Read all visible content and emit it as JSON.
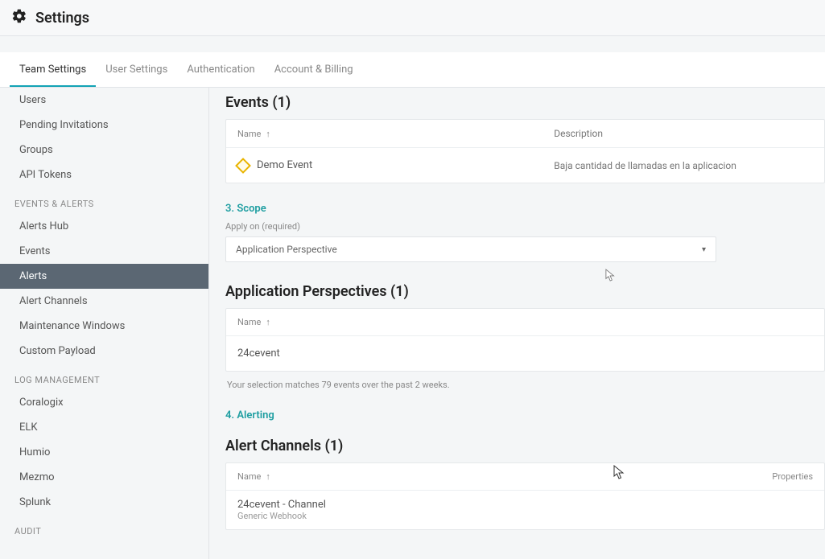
{
  "header": {
    "title": "Settings"
  },
  "tabs": [
    {
      "label": "Team Settings",
      "active": true
    },
    {
      "label": "User Settings"
    },
    {
      "label": "Authentication"
    },
    {
      "label": "Account & Billing"
    }
  ],
  "sidebar": {
    "groups": [
      {
        "label": "",
        "items": [
          {
            "label": "Users"
          },
          {
            "label": "Pending Invitations"
          },
          {
            "label": "Groups"
          },
          {
            "label": "API Tokens"
          }
        ]
      },
      {
        "label": "EVENTS & ALERTS",
        "items": [
          {
            "label": "Alerts Hub"
          },
          {
            "label": "Events"
          },
          {
            "label": "Alerts",
            "active": true
          },
          {
            "label": "Alert Channels"
          },
          {
            "label": "Maintenance Windows"
          },
          {
            "label": "Custom Payload"
          }
        ]
      },
      {
        "label": "LOG MANAGEMENT",
        "items": [
          {
            "label": "Coralogix"
          },
          {
            "label": "ELK"
          },
          {
            "label": "Humio"
          },
          {
            "label": "Mezmo"
          },
          {
            "label": "Splunk"
          }
        ]
      },
      {
        "label": "AUDIT",
        "items": []
      }
    ]
  },
  "main": {
    "events": {
      "heading": "Events (1)",
      "columns": {
        "name": "Name",
        "description": "Description"
      },
      "rows": [
        {
          "name": "Demo Event",
          "description": "Baja cantidad de llamadas en la aplicacion"
        }
      ]
    },
    "scope": {
      "step": "3. Scope",
      "hint": "Apply on (required)",
      "selected": "Application Perspective"
    },
    "perspectives": {
      "heading": "Application Perspectives (1)",
      "columns": {
        "name": "Name"
      },
      "rows": [
        {
          "name": "24cevent"
        }
      ],
      "match_note": "Your selection matches 79 events over the past 2 weeks."
    },
    "alerting": {
      "step": "4. Alerting",
      "heading": "Alert Channels (1)",
      "columns": {
        "name": "Name",
        "properties": "Properties"
      },
      "rows": [
        {
          "name": "24cevent - Channel",
          "sub": "Generic Webhook"
        }
      ]
    }
  }
}
